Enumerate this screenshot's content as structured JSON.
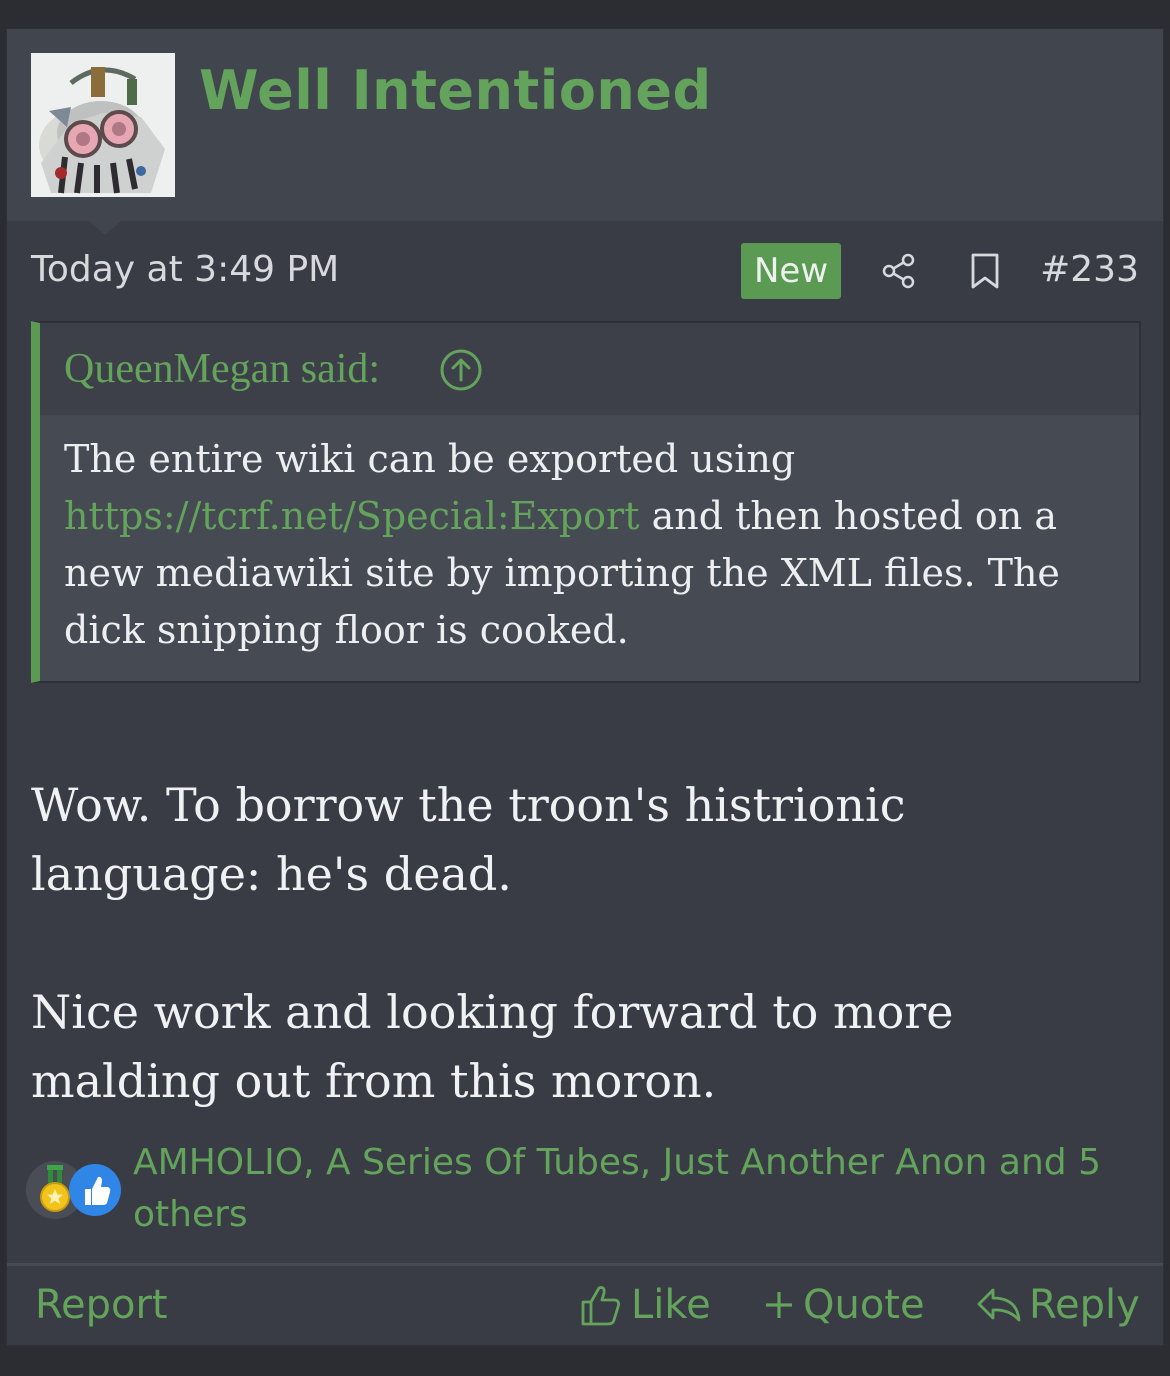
{
  "post": {
    "username": "Well Intentioned",
    "timestamp": "Today at 3:49 PM",
    "badge": "New",
    "post_number": "#233"
  },
  "quote": {
    "author": "QueenMegan said:",
    "text_before": "The entire wiki can be exported using",
    "link": "https://tcrf.net/Special:Export",
    "text_after": "and then hosted on a new mediawiki site by importing the XML files. The dick snipping floor is cooked."
  },
  "message": {
    "p1": "Wow. To borrow the troon's histrionic language: he's dead.",
    "p2": "Nice work and looking forward to more malding out from this moron."
  },
  "reactions": {
    "names": "AMHOLIO, A Series Of Tubes, Just Another Anon and 5 others",
    "icons": [
      "medal-icon",
      "thumbs-up-icon"
    ]
  },
  "footer": {
    "report": "Report",
    "like": "Like",
    "quote": "Quote",
    "reply": "Reply"
  },
  "colors": {
    "accent": "#63a35c",
    "card": "#393c44",
    "header": "#41454d"
  }
}
